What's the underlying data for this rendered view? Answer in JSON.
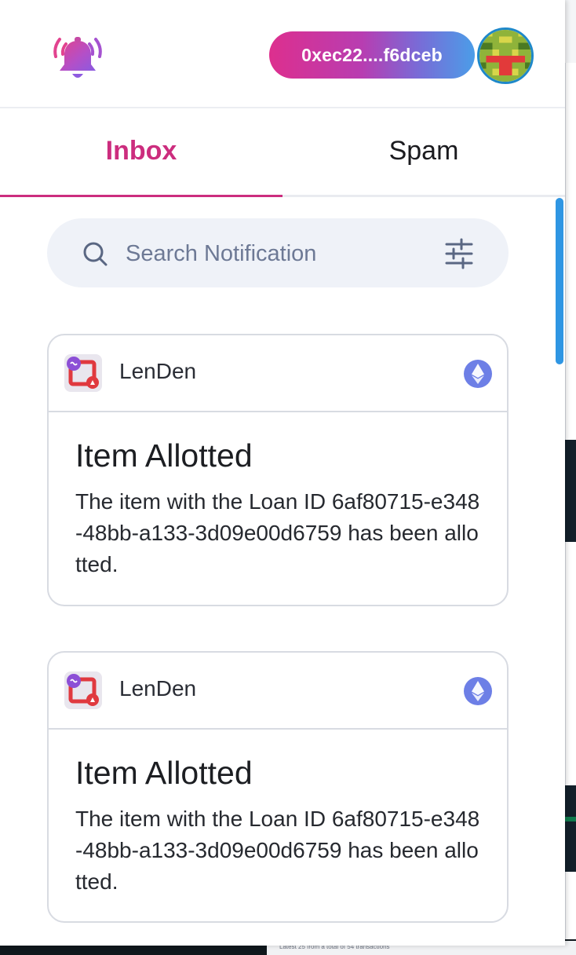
{
  "header": {
    "logo_icon": "bell-ringing-icon",
    "wallet_address": "0xec22....f6dceb",
    "avatar_icon": "blockie-avatar"
  },
  "tabs": [
    {
      "label": "Inbox",
      "active": true
    },
    {
      "label": "Spam",
      "active": false
    }
  ],
  "search": {
    "placeholder": "Search Notification",
    "value": ""
  },
  "notifications": [
    {
      "app_name": "LenDen",
      "app_icon": "lenden-app-icon",
      "chain_icon": "ethereum-icon",
      "title": "Item Allotted",
      "body": "The item with the Loan ID 6af80715-e348-48bb-a133-3d09e00d6759 has been allotted."
    },
    {
      "app_name": "LenDen",
      "app_icon": "lenden-app-icon",
      "chain_icon": "ethereum-icon",
      "title": "Item Allotted",
      "body": "The item with the Loan ID 6af80715-e348-48bb-a133-3d09e00d6759 has been allotted."
    }
  ],
  "background_page": {
    "footer_text": "Latest 25 from a total of 54 transactions"
  },
  "colors": {
    "accent_pink": "#cc2d7e",
    "gradient_start": "#dd2f8e",
    "gradient_end": "#4b9de8",
    "scrollbar": "#2f96e3",
    "ethereum_badge": "#6d7fe6"
  }
}
